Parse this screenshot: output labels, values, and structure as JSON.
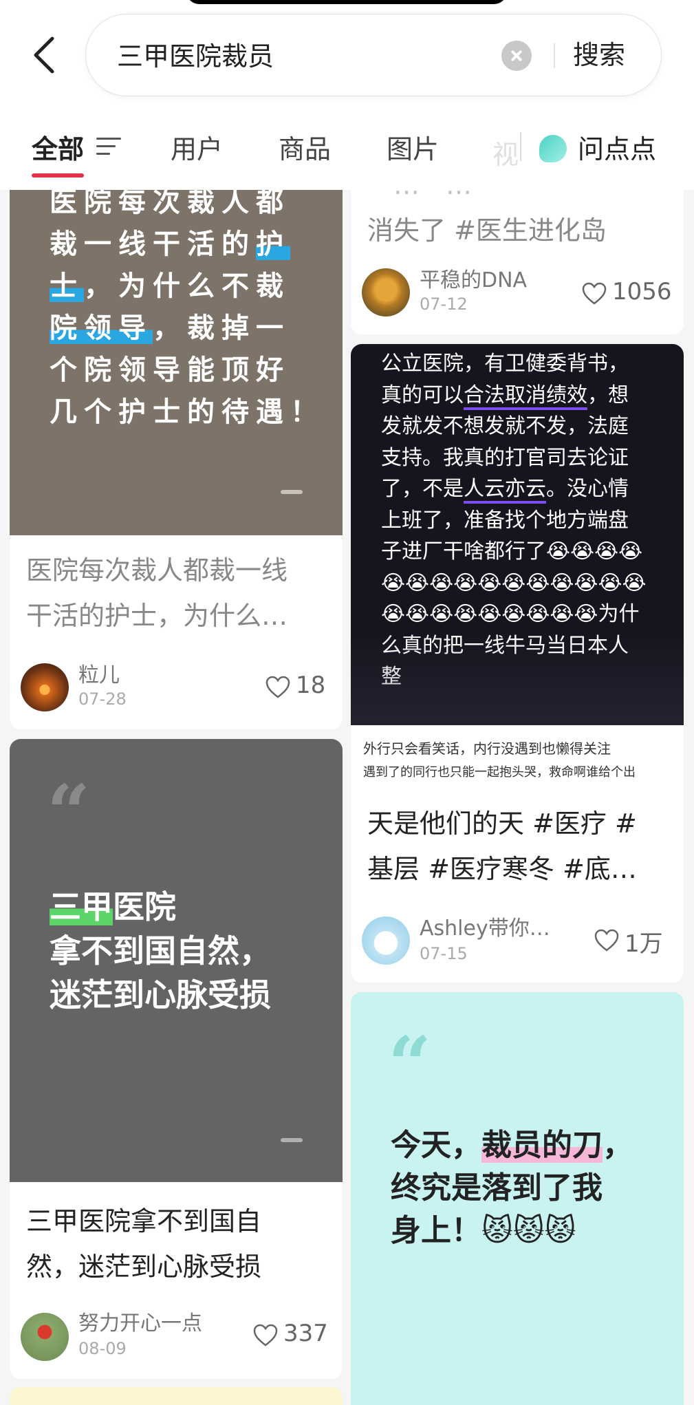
{
  "search": {
    "query": "三甲医院裁员",
    "button": "搜索"
  },
  "tabs": [
    {
      "label": "全部"
    },
    {
      "label": "用户"
    },
    {
      "label": "商品"
    },
    {
      "label": "图片"
    },
    {
      "label": "视"
    },
    {
      "label": "问点点"
    }
  ],
  "cards": {
    "c1": {
      "cover_line1": "医院每次裁人都",
      "cover_line2a": "裁一线干活的",
      "cover_line2b": "护",
      "cover_line3a": "士",
      "cover_line3b": "，为什么不裁",
      "cover_line4a": "院领导",
      "cover_line4b": "，裁掉一",
      "cover_line5": "个院领导能顶好",
      "cover_line6": "几个护士的待遇！",
      "title_line1": "医院每次裁人都裁一线",
      "title_line2": "干活的护士，为什么…",
      "author": "粒儿",
      "date": "07-28",
      "likes": "18"
    },
    "c2": {
      "title_line0": "一…一…",
      "title_line1": "消失了 #医生进化岛",
      "author": "平稳的DNA",
      "date": "07-12",
      "likes": "1056"
    },
    "c3": {
      "cover_line1": "公立医院，有卫健委背书，",
      "cover_line2a": "真的可以",
      "cover_line2b": "合法取消绩效",
      "cover_line2c": "，想",
      "cover_line3": "发就发不想发就不发，法庭",
      "cover_line4": "支持。我真的打官司去论证",
      "cover_line5a": "了，不是",
      "cover_line5b": "人云亦云",
      "cover_line5c": "。没心情",
      "cover_line6": "上班了，准备找个地方端盘",
      "cover_line7": "子进厂干啥都行了😭😭😭😭",
      "cover_line8": "😭😭😭😭😭😭😭😭😭😭😭",
      "cover_line9": "😭😭😭😭😭😭😭😭😭为什",
      "cover_line10": "么真的把一线牛马当日本人",
      "cover_line11": "整",
      "sub_line1": "外行只会看笑话，内行没遇到也懒得关注",
      "sub_line2": "遇到了的同行也只能一起抱头哭，救命啊谁给个出",
      "title_line1": "天是他们的天 #医疗 #",
      "title_line2": "基层 #医疗寒冬 #底…",
      "author": "Ashley带你…",
      "date": "07-15",
      "likes": "1万"
    },
    "c4": {
      "quote": "“",
      "cover_line1a": "三甲",
      "cover_line1b": "医院",
      "cover_line2": "拿不到国自然，",
      "cover_line3": "迷茫到心脉受损",
      "title_line1": "三甲医院拿不到国自",
      "title_line2": "然，迷茫到心脉受损",
      "author": "努力开心一点",
      "date": "08-09",
      "likes": "337"
    },
    "c5": {
      "quote": "“",
      "cover_line1a": "今天，",
      "cover_line1b": "裁员的刀",
      "cover_line1c": "，",
      "cover_line2": "终究是落到了我",
      "cover_line3": "身上！😾😾😾"
    }
  },
  "colors": {
    "accent": "#e3334a",
    "card1_bg": "#7d7368",
    "card3_bg": "#16151f",
    "card4_bg": "#646464",
    "card5_bg": "#c9f3f1"
  }
}
